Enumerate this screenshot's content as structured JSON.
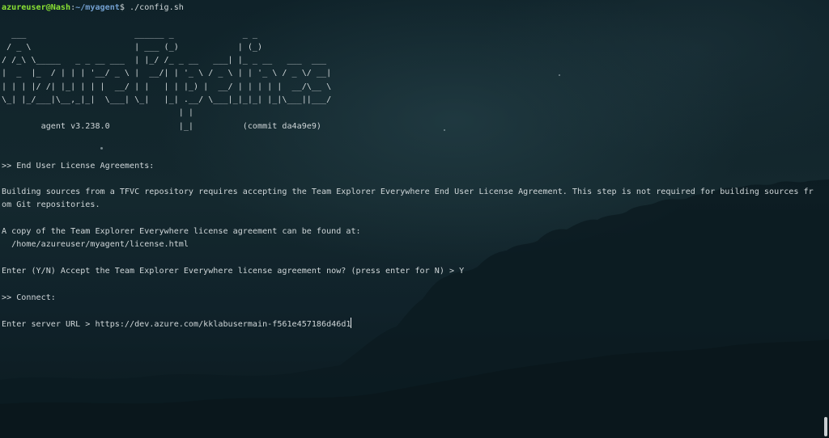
{
  "prompt": {
    "user_host": "azureuser@Nash",
    "colon": ":",
    "path": "~/myagent",
    "symbol": "$",
    "command": " ./config.sh"
  },
  "banner": {
    "ascii_art": [
      "  ___                      ______ _              _ _",
      " / _ \\                     | ___ (_)            | (_)",
      "/ /_\\ \\_____   _ _ __ ___  | |_/ /_ _ __   ___| |_ _ __   ___  ___",
      "|  _  |_  / | | | '__/ _ \\ |  __/| | '_ \\ / _ \\ | | '_ \\ / _ \\/ __|",
      "| | | |/ /| |_| | | |  __/ | |   | | |_) |  __/ | | | | |  __/\\__ \\",
      "\\_| |_/___|\\__,_|_|  \\___| \\_|   |_| .__/ \\___|_|_|_| |_|\\___||___/",
      "                                    | |",
      "        agent v3.238.0              |_|          (commit da4a9e9)"
    ]
  },
  "eula": {
    "heading": ">> End User License Agreements:",
    "description": "Building sources from a TFVC repository requires accepting the Team Explorer Everywhere End User License Agreement. This step is not required for building sources from Git repositories.",
    "copy_notice": "A copy of the Team Explorer Everywhere license agreement can be found at:",
    "license_path": "  /home/azureuser/myagent/license.html",
    "accept_prompt": "Enter (Y/N) Accept the Team Explorer Everywhere license agreement now? (press enter for N) > Y"
  },
  "connect": {
    "heading": ">> Connect:",
    "server_url_prompt": "Enter server URL > ",
    "server_url_value": "https://dev.azure.com/kklabusermain-f561e457186d46d1"
  }
}
